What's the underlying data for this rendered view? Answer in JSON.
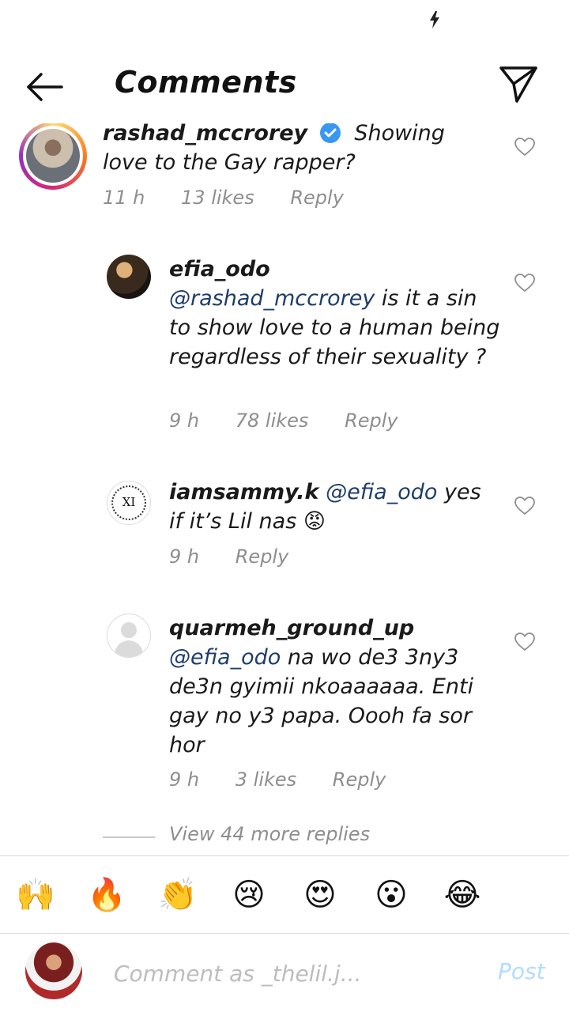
{
  "header": {
    "title": "Comments",
    "back_icon": "arrow-left-icon",
    "dm_icon": "paper-plane-icon"
  },
  "comments": [
    {
      "username": "rashad_mccrorey",
      "verified": true,
      "text": "Showing love to the Gay rapper?",
      "time": "11 h",
      "likes": "13 likes",
      "reply": "Reply"
    },
    {
      "username": "efia_odo",
      "mention": "@rashad_mccrorey",
      "text": "is it a sin to show love to a human being regardless of their sexuality ?",
      "time": "9 h",
      "likes": "78 likes",
      "reply": "Reply"
    },
    {
      "username": "iamsammy.k",
      "mention": "@efia_odo",
      "text": "yes if it’s Lil nas",
      "emoji": "😡",
      "time": "9 h",
      "reply": "Reply",
      "avatar_text": "XI"
    },
    {
      "username": "quarmeh_ground_up",
      "mention": "@efia_odo",
      "text": "na wo de3 3ny3 de3n gyimii nkoaaaaaa.  Enti gay no y3 papa.  Oooh fa sor hor",
      "time": "9 h",
      "likes": "3 likes",
      "reply": "Reply"
    }
  ],
  "view_more": "View 44 more replies",
  "emoji_bar": [
    "🙌",
    "🔥",
    "👏",
    "😢",
    "😍",
    "😮",
    "😂"
  ],
  "compose": {
    "placeholder": "Comment as _thelil.j...",
    "post": "Post"
  },
  "colors": {
    "mention": "#1f3d6b",
    "meta": "#8e8e8e",
    "post": "#b3dbff",
    "verified": "#3897f0"
  }
}
